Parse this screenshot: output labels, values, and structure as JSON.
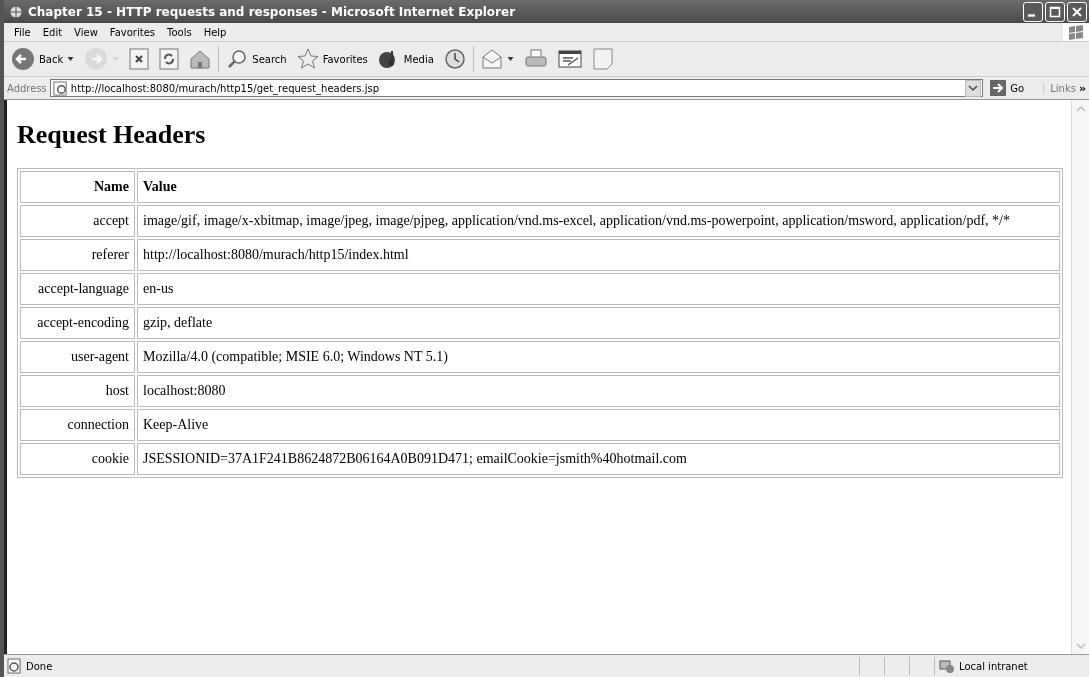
{
  "window": {
    "title": "Chapter 15 - HTTP requests and responses - Microsoft Internet Explorer"
  },
  "menu": [
    "File",
    "Edit",
    "View",
    "Favorites",
    "Tools",
    "Help"
  ],
  "toolbar": [
    {
      "kind": "back",
      "label": "Back",
      "disabled": false
    },
    {
      "kind": "forward",
      "disabled": true
    },
    {
      "kind": "stop",
      "disabled": false
    },
    {
      "kind": "refresh",
      "disabled": false
    },
    {
      "kind": "home",
      "disabled": false
    },
    {
      "kind": "search",
      "label": "Search",
      "disabled": false
    },
    {
      "kind": "favorites",
      "label": "Favorites",
      "disabled": false
    },
    {
      "kind": "media",
      "label": "Media",
      "disabled": false
    },
    {
      "kind": "history",
      "disabled": false
    },
    {
      "kind": "mail",
      "disabled": false
    },
    {
      "kind": "print",
      "disabled": false
    },
    {
      "kind": "edit",
      "disabled": false
    },
    {
      "kind": "blank",
      "disabled": false
    }
  ],
  "address": {
    "label": "Address",
    "url": "http://localhost:8080/murach/http15/get_request_headers.jsp",
    "go": "Go",
    "links": "Links",
    "more": "»"
  },
  "page": {
    "heading": "Request Headers",
    "columns": [
      "Name",
      "Value"
    ],
    "rows": [
      [
        "accept",
        "image/gif, image/x-xbitmap, image/jpeg, image/pjpeg, application/vnd.ms-excel, application/vnd.ms-powerpoint, application/msword, application/pdf, */*"
      ],
      [
        "referer",
        "http://localhost:8080/murach/http15/index.html"
      ],
      [
        "accept-language",
        "en-us"
      ],
      [
        "accept-encoding",
        "gzip, deflate"
      ],
      [
        "user-agent",
        "Mozilla/4.0 (compatible; MSIE 6.0; Windows NT 5.1)"
      ],
      [
        "host",
        "localhost:8080"
      ],
      [
        "connection",
        "Keep-Alive"
      ],
      [
        "cookie",
        "JSESSIONID=37A1F241B8624872B06164A0B091D471; emailCookie=jsmith%40hotmail.com"
      ]
    ]
  },
  "status_bar": {
    "text": "Done",
    "zone": "Local intranet"
  }
}
